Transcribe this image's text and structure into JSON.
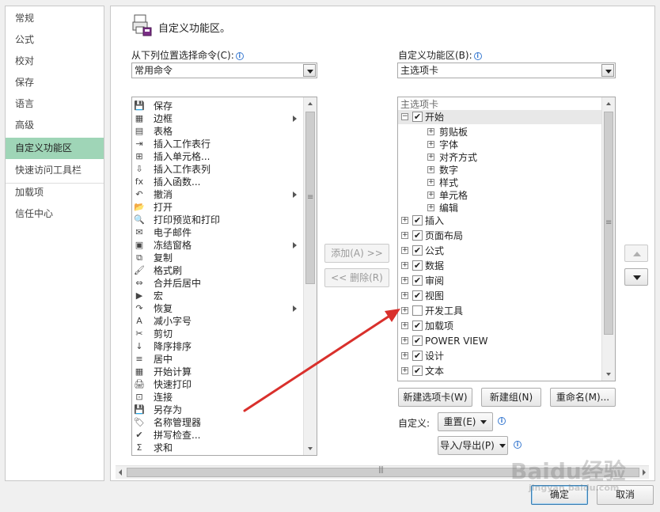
{
  "nav": {
    "items": [
      {
        "label": "常规"
      },
      {
        "label": "公式"
      },
      {
        "label": "校对"
      },
      {
        "label": "保存"
      },
      {
        "label": "语言"
      },
      {
        "label": "高级"
      },
      {
        "label": "自定义功能区",
        "active": true
      },
      {
        "label": "快速访问工具栏"
      },
      {
        "label": "加载项"
      },
      {
        "label": "信任中心"
      }
    ]
  },
  "header": {
    "title": "自定义功能区。"
  },
  "left_panel": {
    "label": "从下列位置选择命令(C):",
    "combo_value": "常用命令",
    "commands": [
      {
        "label": "保存",
        "icon": "💾",
        "submenu": false
      },
      {
        "label": "边框",
        "icon": "▦",
        "submenu": true
      },
      {
        "label": "表格",
        "icon": "▤",
        "submenu": false
      },
      {
        "label": "插入工作表行",
        "icon": "⇥",
        "submenu": false
      },
      {
        "label": "插入单元格...",
        "icon": "⊞",
        "submenu": false
      },
      {
        "label": "插入工作表列",
        "icon": "⇩",
        "submenu": false
      },
      {
        "label": "插入函数...",
        "icon": "fx",
        "submenu": false
      },
      {
        "label": "撤消",
        "icon": "↶",
        "submenu": true
      },
      {
        "label": "打开",
        "icon": "📂",
        "submenu": false
      },
      {
        "label": "打印预览和打印",
        "icon": "🔍",
        "submenu": false
      },
      {
        "label": "电子邮件",
        "icon": "✉",
        "submenu": false
      },
      {
        "label": "冻结窗格",
        "icon": "▣",
        "submenu": true
      },
      {
        "label": "复制",
        "icon": "⧉",
        "submenu": false
      },
      {
        "label": "格式刷",
        "icon": "🖌",
        "submenu": false
      },
      {
        "label": "合并后居中",
        "icon": "⇔",
        "submenu": false
      },
      {
        "label": "宏",
        "icon": "▶",
        "submenu": false
      },
      {
        "label": "恢复",
        "icon": "↷",
        "submenu": true
      },
      {
        "label": "减小字号",
        "icon": "A",
        "submenu": false
      },
      {
        "label": "剪切",
        "icon": "✂",
        "submenu": false
      },
      {
        "label": "降序排序",
        "icon": "↓",
        "submenu": false
      },
      {
        "label": "居中",
        "icon": "≡",
        "submenu": false
      },
      {
        "label": "开始计算",
        "icon": "▦",
        "submenu": false
      },
      {
        "label": "快速打印",
        "icon": "🖨",
        "submenu": false
      },
      {
        "label": "连接",
        "icon": "⊡",
        "submenu": false
      },
      {
        "label": "另存为",
        "icon": "💾",
        "submenu": false
      },
      {
        "label": "名称管理器",
        "icon": "🏷",
        "submenu": false
      },
      {
        "label": "拼写检查...",
        "icon": "✔",
        "submenu": false
      },
      {
        "label": "求和",
        "icon": "Σ",
        "submenu": false
      }
    ]
  },
  "middle": {
    "add_label": "添加(A) >>",
    "remove_label": "<< 删除(R)"
  },
  "right_panel": {
    "label": "自定义功能区(B):",
    "combo_value": "主选项卡",
    "tree_header": "主选项卡",
    "tree": [
      {
        "label": "开始",
        "level": 0,
        "expander": "⊟",
        "checked": true,
        "selected": true
      },
      {
        "label": "剪贴板",
        "level": 1,
        "expander": "+"
      },
      {
        "label": "字体",
        "level": 1,
        "expander": "+"
      },
      {
        "label": "对齐方式",
        "level": 1,
        "expander": "+"
      },
      {
        "label": "数字",
        "level": 1,
        "expander": "+"
      },
      {
        "label": "样式",
        "level": 1,
        "expander": "+"
      },
      {
        "label": "单元格",
        "level": 1,
        "expander": "+"
      },
      {
        "label": "编辑",
        "level": 1,
        "expander": "+"
      },
      {
        "label": "插入",
        "level": 0,
        "expander": "+",
        "checked": true
      },
      {
        "label": "页面布局",
        "level": 0,
        "expander": "+",
        "checked": true
      },
      {
        "label": "公式",
        "level": 0,
        "expander": "+",
        "checked": true
      },
      {
        "label": "数据",
        "level": 0,
        "expander": "+",
        "checked": true
      },
      {
        "label": "审阅",
        "level": 0,
        "expander": "+",
        "checked": true
      },
      {
        "label": "视图",
        "level": 0,
        "expander": "+",
        "checked": true
      },
      {
        "label": "开发工具",
        "level": 0,
        "expander": "+",
        "checked": false
      },
      {
        "label": "加载项",
        "level": 0,
        "expander": "+",
        "checked": true
      },
      {
        "label": "POWER VIEW",
        "level": 0,
        "expander": "+",
        "checked": true
      },
      {
        "label": "设计",
        "level": 0,
        "expander": "+",
        "checked": true
      },
      {
        "label": "文本",
        "level": 0,
        "expander": "+",
        "checked": true
      }
    ],
    "new_tab_label": "新建选项卡(W)",
    "new_group_label": "新建组(N)",
    "rename_label": "重命名(M)...",
    "customize_label": "自定义:",
    "reset_label": "重置(E)",
    "import_export_label": "导入/导出(P)"
  },
  "footer": {
    "ok_label": "确定",
    "cancel_label": "取消"
  },
  "watermark": {
    "text": "Baidu经验",
    "sub": "jingyan.baidu.com"
  },
  "colors": {
    "active_nav": "#9fd5b7",
    "annotation_arrow": "#d9302c",
    "selected_row": "#e8e8e8"
  }
}
